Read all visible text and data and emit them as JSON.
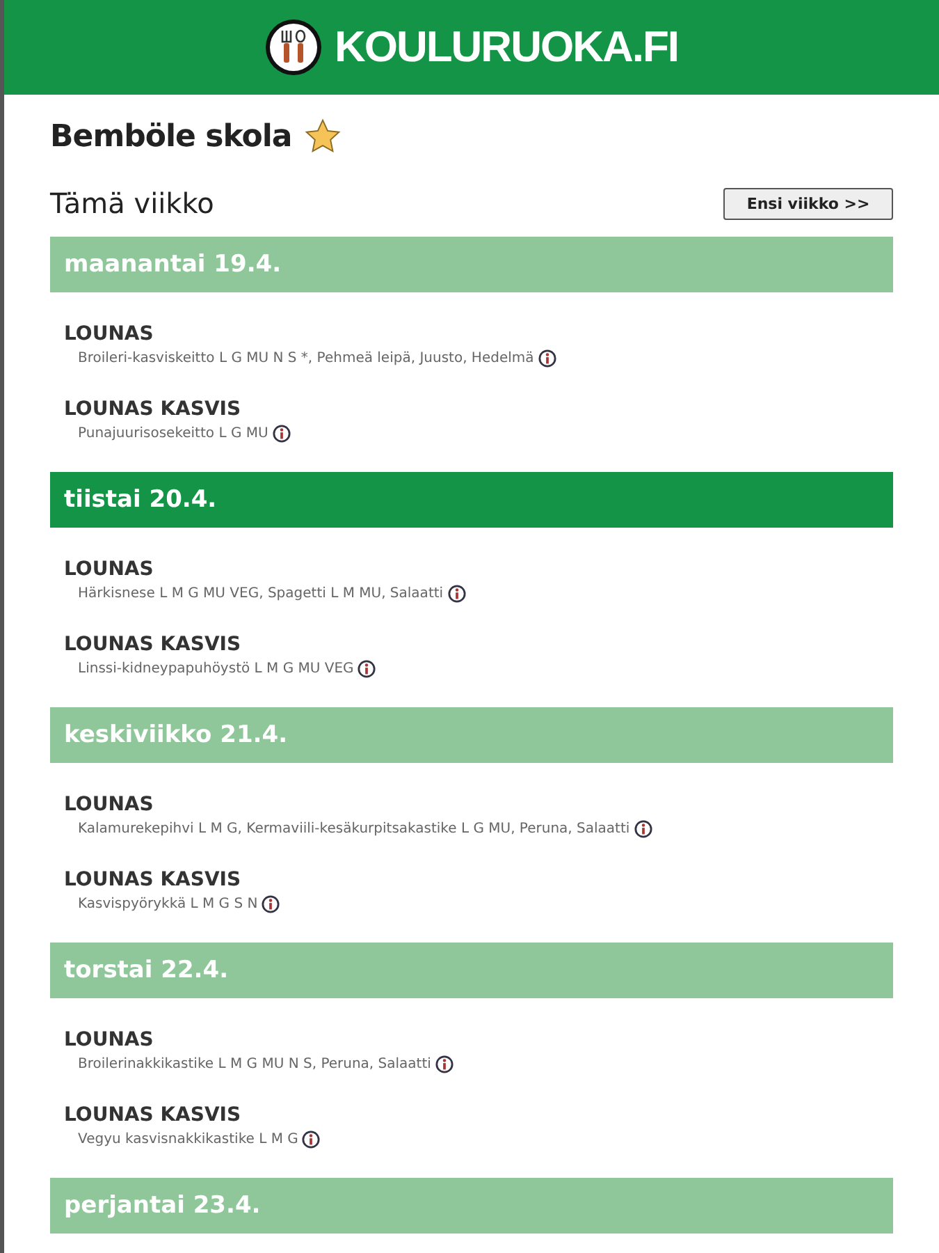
{
  "header": {
    "logo_text": "KOULURUOKA.FI"
  },
  "school": {
    "name": "Bemböle skola",
    "favorite": true
  },
  "week": {
    "title": "Tämä viikko",
    "next_button": "Ensi viikko >>"
  },
  "days": [
    {
      "label": "maanantai 19.4.",
      "today": false,
      "meals": [
        {
          "title": "LOUNAS",
          "items": "Broileri-kasviskeitto L G MU N S *, Pehmeä leipä, Juusto, Hedelmä"
        },
        {
          "title": "LOUNAS KASVIS",
          "items": "Punajuurisosekeitto L G MU"
        }
      ]
    },
    {
      "label": "tiistai 20.4.",
      "today": true,
      "meals": [
        {
          "title": "LOUNAS",
          "items": "Härkisnese L M G MU VEG, Spagetti L M MU, Salaatti"
        },
        {
          "title": "LOUNAS KASVIS",
          "items": "Linssi-kidneypapuhöystö L M G MU VEG"
        }
      ]
    },
    {
      "label": "keskiviikko 21.4.",
      "today": false,
      "meals": [
        {
          "title": "LOUNAS",
          "items": "Kalamurekepihvi L M G, Kermaviili-kesäkurpitsakastike L G MU, Peruna, Salaatti"
        },
        {
          "title": "LOUNAS KASVIS",
          "items": "Kasvispyörykkä L M G S N"
        }
      ]
    },
    {
      "label": "torstai 22.4.",
      "today": false,
      "meals": [
        {
          "title": "LOUNAS",
          "items": "Broilerinakkikastike L M G MU N S, Peruna, Salaatti"
        },
        {
          "title": "LOUNAS KASVIS",
          "items": "Vegyu kasvisnakkikastike L M G"
        }
      ]
    },
    {
      "label": "perjantai 23.4.",
      "today": false
    }
  ]
}
